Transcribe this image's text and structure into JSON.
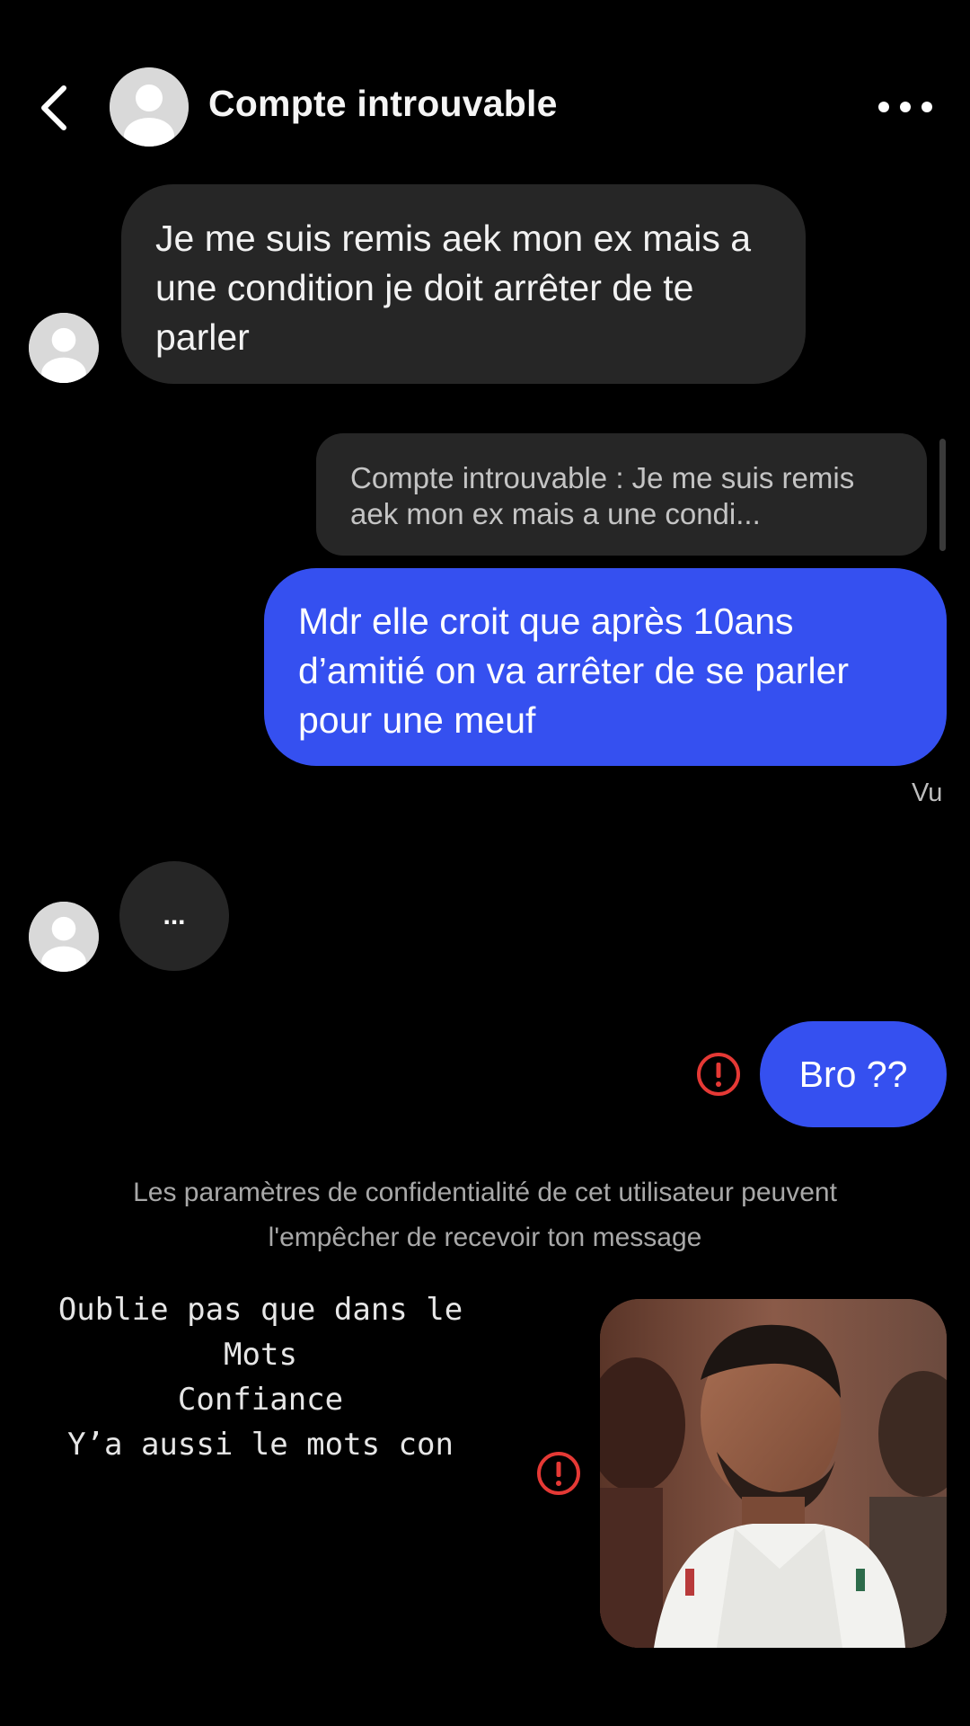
{
  "header": {
    "title": "Compte introuvable",
    "back_icon": "chevron-left-icon",
    "more_icon": "more-horizontal-icon"
  },
  "messages": {
    "incoming_1": "Je me suis remis aek mon ex mais a une condition je doit arrêter de te parler",
    "reply_quote": "Compte introuvable : Je me suis remis aek mon ex mais a une condi...",
    "outgoing_1": "Mdr elle croit que après 10ans d’amitié on va arrêter de se parler pour une meuf",
    "seen_label": "Vu",
    "typing": "...",
    "outgoing_2": "Bro ??"
  },
  "privacy_note": "Les paramètres de confidentialité de cet utilisateur peuvent l'empêcher de recevoir ton message",
  "caption": {
    "line1": "Oublie pas que dans le",
    "line2": "Mots",
    "line3": "Confiance",
    "line4": "Y’a aussi le mots con"
  },
  "colors": {
    "background": "#000000",
    "incoming_bubble": "#262626",
    "outgoing_bubble": "#3550f0",
    "error": "#e53935"
  }
}
